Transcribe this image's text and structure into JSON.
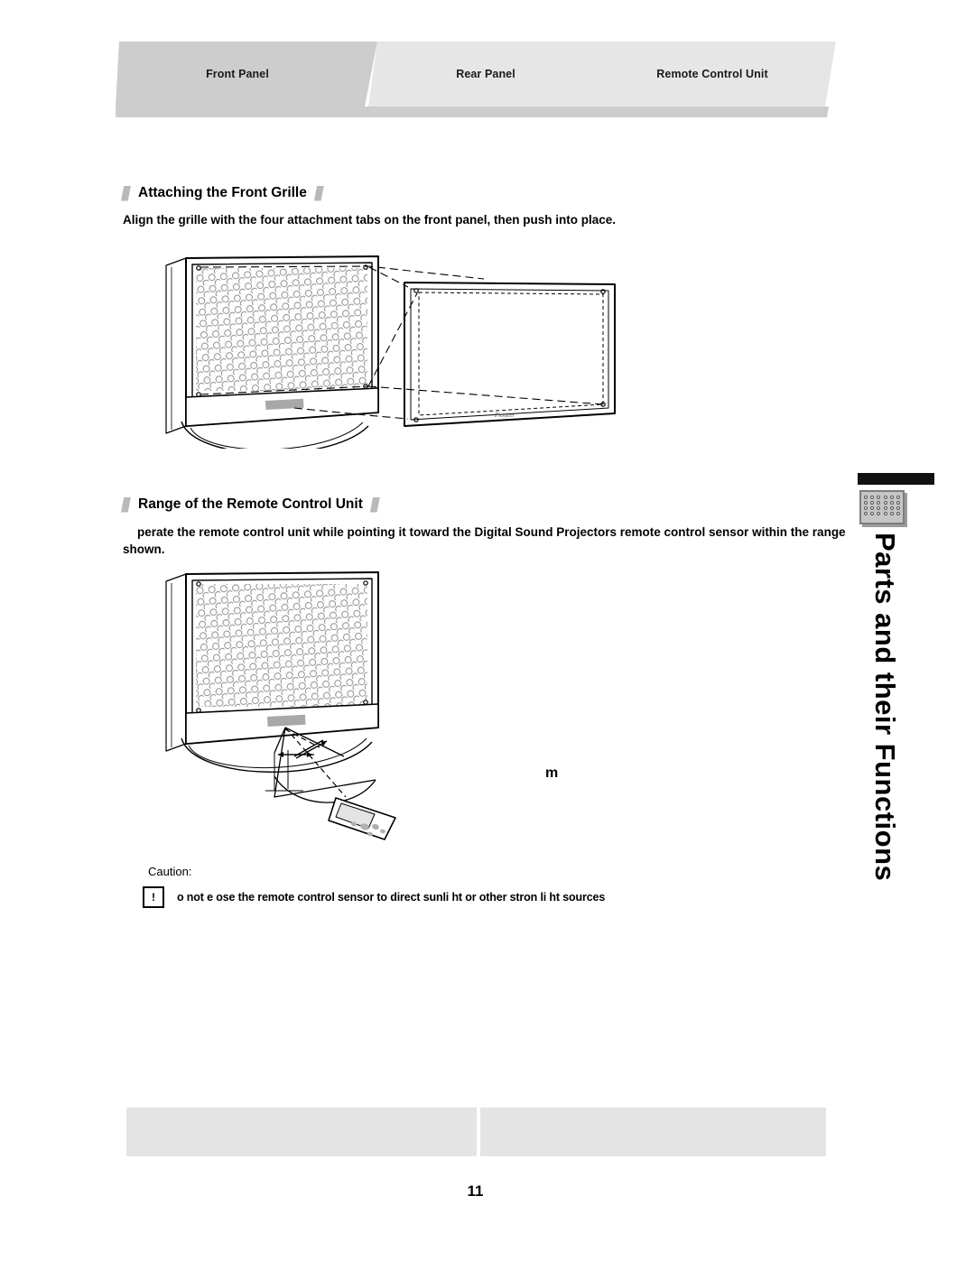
{
  "header": {
    "tabs": [
      {
        "label": "Front Panel",
        "state": "active"
      },
      {
        "label": "Rear Panel",
        "state": "inactive"
      },
      {
        "label": "Remote Control Unit",
        "state": "inactive"
      }
    ]
  },
  "sections": [
    {
      "id": "attaching-front-grille",
      "heading": "Attaching the Front Grille",
      "body": "Align the grille with the four attachment tabs on the front panel, then push into place.",
      "figure": {
        "name": "front-grille-attachment-diagram",
        "brand_mark": "Pioneer",
        "description": "Line drawing of the Digital Sound Projector front panel with perforated grille at left and the detachable front grille panel at right, connected by dashed alignment lines at four attachment tabs."
      }
    },
    {
      "id": "range-of-remote-control-unit",
      "heading": "Range of the Remote Control Unit",
      "body": "perate the remote control unit while pointing it toward the Digital Sound Projectors remote control sensor within the range shown.",
      "figure": {
        "name": "remote-control-range-diagram",
        "distance_label": "m",
        "description": "Line drawing of the Digital Sound Projector with an angular range cone projecting from the remote control sensor toward a handheld remote control unit."
      }
    }
  ],
  "caution": {
    "label": "Caution:",
    "icon": "warning-exclamation-icon",
    "icon_glyph": "!",
    "text": "o not e   ose the remote control sensor to direct sunli  ht or other stron   li  ht sources"
  },
  "side_tab": {
    "title": "Parts and their Functions",
    "icon": "speaker-grille-icon"
  },
  "footer": {
    "page_number": "11"
  },
  "colors": {
    "tab_active": "#cdcdcd",
    "tab_inactive": "#e6e6e6",
    "heading_mark": "#b9b9b9",
    "footer_box": "#e4e4e4",
    "side_bar": "#111111"
  }
}
